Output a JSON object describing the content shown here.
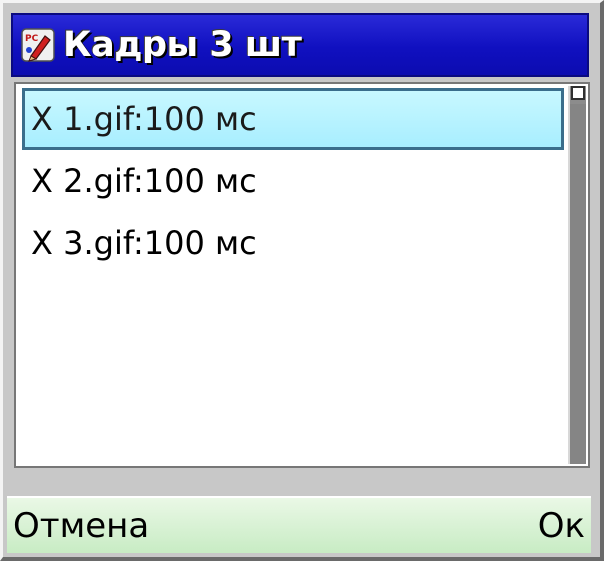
{
  "title": {
    "text": "Кадры 3 шт",
    "icon": "paint-app-icon"
  },
  "frames": [
    {
      "label": "X 1.gif:100 мс",
      "selected": true
    },
    {
      "label": "X 2.gif:100 мс",
      "selected": false
    },
    {
      "label": "X 3.gif:100 мс",
      "selected": false
    }
  ],
  "softkeys": {
    "left": "Отмена",
    "right": "Ок"
  },
  "colors": {
    "titlebar": "#1010c0",
    "selection": "#a8eeff",
    "softbar": "#c8ecc4"
  }
}
